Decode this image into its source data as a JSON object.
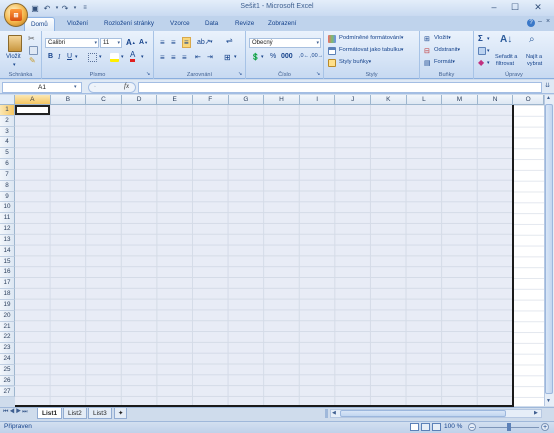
{
  "window": {
    "title": "Sešit1 - Microsoft Excel"
  },
  "ribbon_tabs": [
    "Domů",
    "Vložení",
    "Rozložení stránky",
    "Vzorce",
    "Data",
    "Revize",
    "Zobrazení"
  ],
  "groups": {
    "clipboard": {
      "label": "Schránka",
      "paste": "Vložit"
    },
    "font": {
      "label": "Písmo",
      "font_name": "Calibri",
      "font_size": "11"
    },
    "alignment": {
      "label": "Zarovnání"
    },
    "number": {
      "label": "Číslo",
      "format": "Obecný"
    },
    "styles": {
      "label": "Styly",
      "conditional": "Podmíněné formátování",
      "as_table": "Formátovat jako tabulku",
      "cell_styles": "Styly buňky"
    },
    "cells": {
      "label": "Buňky",
      "insert": "Vložit",
      "delete": "Odstranit",
      "format": "Formát"
    },
    "editing": {
      "label": "Úpravy",
      "sort_filter_1": "Seřadit a",
      "sort_filter_2": "filtrovat",
      "find_1": "Najít a",
      "find_2": "vybrat"
    }
  },
  "formula_bar": {
    "name_box": "A1",
    "fx": "fx",
    "formula": ""
  },
  "columns": [
    "A",
    "B",
    "C",
    "D",
    "E",
    "F",
    "G",
    "H",
    "I",
    "J",
    "K",
    "L",
    "M",
    "N",
    "O"
  ],
  "rows": [
    "1",
    "2",
    "3",
    "4",
    "5",
    "6",
    "7",
    "8",
    "9",
    "10",
    "11",
    "12",
    "13",
    "14",
    "15",
    "16",
    "17",
    "18",
    "19",
    "20",
    "21",
    "22",
    "23",
    "24",
    "25",
    "26",
    "27"
  ],
  "sheets": [
    "List1",
    "List2",
    "List3"
  ],
  "status": {
    "ready": "Připraven",
    "zoom": "100 %"
  }
}
